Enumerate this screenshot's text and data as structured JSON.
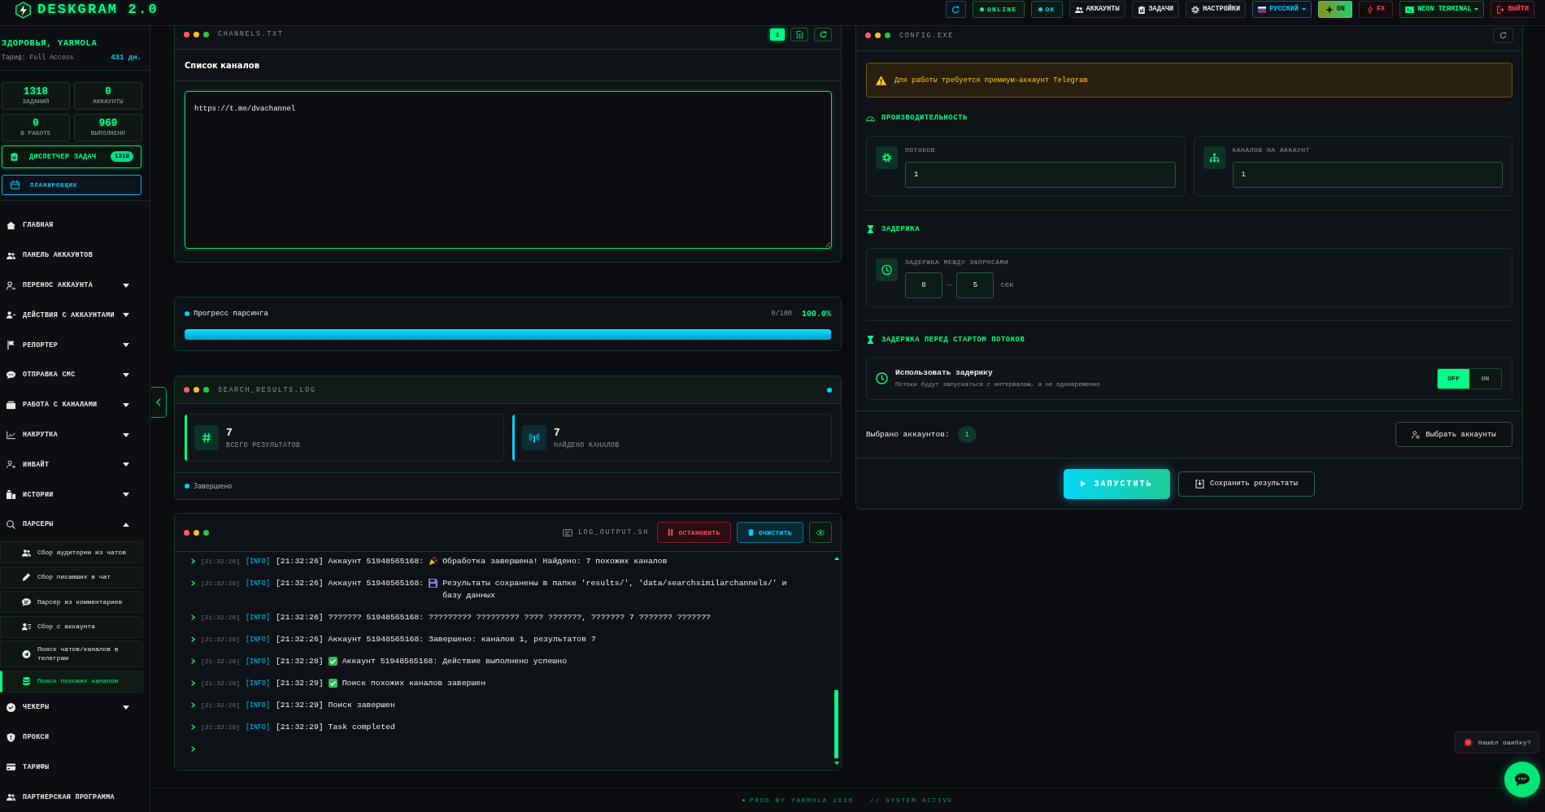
{
  "topbar": {
    "logo": "DESKGRAM 2.0",
    "items": [
      {
        "kind": "refresh"
      },
      {
        "kind": "status",
        "label": "ONLINE",
        "color": "#00ff88"
      },
      {
        "kind": "status",
        "label": "OK",
        "color": "#00d4ff"
      },
      {
        "kind": "nav",
        "label": "АККАУНТЫ"
      },
      {
        "kind": "nav",
        "label": "ЗАДАЧИ"
      },
      {
        "kind": "nav",
        "label": "НАСТРОЙКИ"
      },
      {
        "kind": "language",
        "label": "РУССКИЙ"
      },
      {
        "kind": "toggle",
        "label": "ON",
        "on": true
      },
      {
        "kind": "fx",
        "label": "FX"
      },
      {
        "kind": "theme",
        "label": "NEON TERMINAL"
      },
      {
        "kind": "logout",
        "label": "ВЫЙТИ"
      }
    ]
  },
  "sidebar": {
    "greeting": "ЗДОРОВЬЯ, YARMOLA",
    "plan": "Тариф: Full Access",
    "days_left": "431 дн.",
    "stats": [
      {
        "value": "1318",
        "label": "ЗАДАНИЙ"
      },
      {
        "value": "0",
        "label": "АККАУНТЫ"
      },
      {
        "value": "0",
        "label": "В РАБОТЕ"
      },
      {
        "value": "969",
        "label": "ВЫПОЛНЕНО"
      }
    ],
    "task_manager": {
      "label": "ДИСПЕТЧЕР ЗАДАЧ",
      "count": "1318"
    },
    "scheduler": "ПЛАНИРОВЩИК",
    "nav": [
      {
        "label": "ГЛАВНАЯ",
        "selected": false
      },
      {
        "label": "ПАНЕЛЬ АККАУНТОВ",
        "selected": false
      },
      {
        "label": "ПЕРЕНОС АККАУНТА",
        "selected": false,
        "expanded": false
      },
      {
        "label": "ДЕЙСТВИЯ С АККАУНТАМИ",
        "selected": false,
        "expanded": false
      },
      {
        "label": "РЕПОРТЕР",
        "selected": false,
        "expanded": false
      },
      {
        "label": "ОТПРАВКА СМС",
        "selected": false,
        "expanded": false
      },
      {
        "label": "РАБОТА С КАНАЛАМИ",
        "selected": false,
        "expanded": false
      },
      {
        "label": "НАКРУТКА",
        "selected": false,
        "expanded": false
      },
      {
        "label": "ИНВАЙТ",
        "selected": false,
        "expanded": false
      },
      {
        "label": "ИСТОРИИ",
        "selected": false,
        "expanded": false
      },
      {
        "label": "ПАРСЕРЫ",
        "selected": false,
        "expanded": true,
        "children": [
          {
            "label": "Сбор аудитории из чатов",
            "selected": false
          },
          {
            "label": "Сбор писавших в чат",
            "selected": false
          },
          {
            "label": "Парсер из комментариев",
            "selected": false
          },
          {
            "label": "Сбор с аккаунта",
            "selected": false
          },
          {
            "label": "Поиск чатов/каналов в телеграм",
            "selected": false
          },
          {
            "label": "Поиск похожих каналов",
            "selected": true
          }
        ]
      },
      {
        "label": "ЧЕКЕРЫ",
        "selected": false,
        "expanded": false
      },
      {
        "label": "ПРОКСИ",
        "selected": false
      },
      {
        "label": "ТАРИФЫ",
        "selected": false
      },
      {
        "label": "ПАРТНЕРСКАЯ ПРОГРАММА",
        "selected": false
      }
    ]
  },
  "channels": {
    "title": "CHANNELS.TXT",
    "count": "1",
    "heading": "Список каналов",
    "value": "https://t.me/dvachannel"
  },
  "progress": {
    "label": "Прогресс парсинга",
    "count": "0/100",
    "percent": "100.0%",
    "level": 1
  },
  "results": {
    "title": "SEARCH_RESULTS.LOG",
    "stats": [
      {
        "value": "7",
        "label": "ВСЕГО РЕЗУЛЬТАТОВ",
        "color": "#00ff88"
      },
      {
        "value": "7",
        "label": "НАЙДЕНО КАНАЛОВ",
        "color": "#00d4ff"
      }
    ],
    "status": "Завершено"
  },
  "log": {
    "title": "LOG_OUTPUT.SH",
    "buttons": [
      {
        "kind": "stop",
        "label": "ОСТАНОВИТЬ"
      },
      {
        "kind": "clear",
        "label": "ОЧИСТИТЬ"
      },
      {
        "kind": "view"
      }
    ],
    "entries": [
      {
        "time": "[21:32:26]",
        "level": "[INFO]",
        "kind": "party",
        "text": "[21:32:26] Аккаунт 51948565168:",
        "detail": "Обработка завершена! Найдено: 7 похожих каналов"
      },
      {
        "time": "[21:32:26]",
        "level": "[INFO]",
        "kind": "disk",
        "text": "[21:32:26] Аккаунт 51948565168:",
        "detail": "Результаты сохранены в папке 'results/', 'data/searchsimilarchannels/' и базу данных"
      },
      {
        "time": "[21:32:26]",
        "level": "[INFO]",
        "kind": "plain",
        "text": "[21:32:26] ??????? 51948565168: ????????? ????????? ???? ???????, ??????? 7 ??????? ???????"
      },
      {
        "time": "[21:32:26]",
        "level": "[INFO]",
        "kind": "plain",
        "text": "[21:32:26] Аккаунт 51948565168: Завершено: каналов 1, результатов 7"
      },
      {
        "time": "[21:32:28]",
        "level": "[INFO]",
        "kind": "check",
        "text": "[21:32:28]",
        "detail": "Аккаунт 51948565168: Действие выполнено успешно"
      },
      {
        "time": "[21:32:29]",
        "level": "[INFO]",
        "kind": "check",
        "text": "[21:32:29]",
        "detail": "Поиск похожих каналов завершен"
      },
      {
        "time": "[21:32:29]",
        "level": "[INFO]",
        "kind": "plain",
        "text": "[21:32:29] Поиск завершен"
      },
      {
        "time": "[21:32:29]",
        "level": "[INFO]",
        "kind": "plain",
        "text": "[21:32:29] Task completed"
      }
    ]
  },
  "config": {
    "title": "CONFIG.EXE",
    "warning": "Для работы требуется премиум-аккаунт Telegram",
    "sections": [
      {
        "kind": "fields",
        "title": "ПРОИЗВОДИТЕЛЬНОСТЬ",
        "fields": [
          {
            "label": "ПОТОКОВ",
            "value": "1"
          },
          {
            "label": "КАНАЛОВ НА АККАУНТ",
            "value": "1"
          }
        ]
      },
      {
        "kind": "range",
        "title": "ЗАДЕРЖКА",
        "label": "ЗАДЕРЖКА МЕЖДУ ЗАПРОСАМИ",
        "from": "8",
        "separator": "—",
        "to": "5",
        "unit": "сек"
      },
      {
        "kind": "switch",
        "title": "ЗАДЕРЖКА ПЕРЕД СТАРТОМ ПОТОКОВ",
        "label": "Использовать задержку",
        "description": "Потоки будут запускаться с интервалом, а не одновременно",
        "options": [
          {
            "label": "OFF",
            "selected": true
          },
          {
            "label": "ON",
            "selected": false
          }
        ]
      }
    ],
    "selected_accounts": {
      "label": "Выбрано аккаунтов:",
      "count": "1"
    },
    "choose_button": "Выбрать аккаунты",
    "actions": [
      {
        "kind": "primary",
        "label": "ЗАПУСТИТЬ"
      },
      {
        "kind": "secondary",
        "label": "Сохранить результаты"
      }
    ]
  },
  "footer": {
    "credit": "PROD BY YARMOLA 2026",
    "status": "// SYSTEM ACTIVE"
  },
  "help": {
    "report": "Нашёл ошибку?"
  }
}
